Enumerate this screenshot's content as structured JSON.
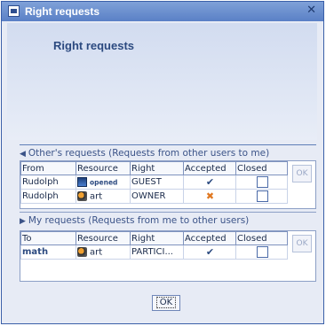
{
  "window": {
    "title": "Right requests",
    "close_glyph": "✕"
  },
  "header": {
    "title": "Right requests"
  },
  "others": {
    "label": "Other's requests (Requests from other users to me)",
    "columns": [
      "From",
      "Resource",
      "Right",
      "Accepted",
      "Closed"
    ],
    "rows": [
      {
        "from": "Rudolph",
        "resource_icon": "document-icon",
        "resource": "opened",
        "right": "GUEST",
        "accepted": "check",
        "closed": false
      },
      {
        "from": "Rudolph",
        "resource_icon": "art-icon",
        "resource": "art",
        "right": "OWNER",
        "accepted": "cross",
        "closed": false
      }
    ],
    "ok_label": "OK"
  },
  "mine": {
    "label": "My requests (Requests from me to other users)",
    "columns": [
      "To",
      "Resource",
      "Right",
      "Accepted",
      "Closed"
    ],
    "rows": [
      {
        "to": "math",
        "resource_icon": "art-icon",
        "resource": "art",
        "right": "PARTICI...",
        "accepted": "check",
        "closed": false
      }
    ],
    "ok_label": "OK"
  },
  "footer": {
    "ok_label": "OK"
  },
  "colors": {
    "titlebar": "#5a80c6",
    "accent": "#2c4a80",
    "cross": "#e07820"
  }
}
